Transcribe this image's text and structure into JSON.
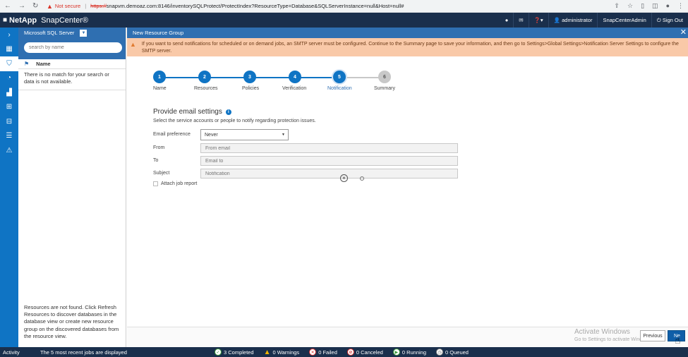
{
  "browser": {
    "warning_icon": "warning-icon",
    "not_secure": "Not secure",
    "url_scheme": "https://",
    "url_rest": "snapvm.demoaz.com:8146/inventorySQLProtect/ProtectIndex?ResourceType=Database&SQLServerInstance=null&Host=null#"
  },
  "header": {
    "brand": "NetApp",
    "product": "SnapCenter®",
    "user": "administrator",
    "role": "SnapCenterAdmin",
    "sign_out": "Sign Out"
  },
  "left_panel": {
    "title": "Microsoft SQL Server",
    "search_placeholder": "search by name",
    "column_name": "Name",
    "no_match": "There is no match for your search or data is not available.",
    "footer": "Resources are not found. Click Refresh Resources to discover databases in the database view or create new resource group on the discovered databases from the resource view."
  },
  "main": {
    "title": "New Resource Group",
    "alert": "If you want to send notifications for scheduled or on demand jobs, an SMTP server must be configured. Continue to the Summary page to save your information, and then go to Settings>Global Settings>Notification Server Settings to configure the SMTP server.",
    "steps": [
      {
        "num": "1",
        "label": "Name",
        "state": "done"
      },
      {
        "num": "2",
        "label": "Resources",
        "state": "done"
      },
      {
        "num": "3",
        "label": "Policies",
        "state": "done"
      },
      {
        "num": "4",
        "label": "Verification",
        "state": "done"
      },
      {
        "num": "5",
        "label": "Notification",
        "state": "current"
      },
      {
        "num": "6",
        "label": "Summary",
        "state": "pending"
      }
    ],
    "form": {
      "title": "Provide email settings",
      "subtitle": "Select the service accounts or people to notify regarding protection issues.",
      "email_pref_label": "Email preference",
      "email_pref_value": "Never",
      "from_label": "From",
      "from_placeholder": "From email",
      "to_label": "To",
      "to_placeholder": "Email to",
      "subject_label": "Subject",
      "subject_placeholder": "Notification",
      "attach_label": "Attach job report"
    },
    "buttons": {
      "previous": "Previous",
      "next": "Ne"
    },
    "watermark": {
      "line1": "Activate Windows",
      "line2": "Go to Settings to activate Windows."
    }
  },
  "status_bar": {
    "activity": "Activity",
    "jobs": "The 5 most recent jobs are displayed",
    "completed": "3 Completed",
    "warnings": "0 Warnings",
    "failed": "0 Failed",
    "canceled": "0 Canceled",
    "running": "0 Running",
    "queued": "0 Queued"
  }
}
